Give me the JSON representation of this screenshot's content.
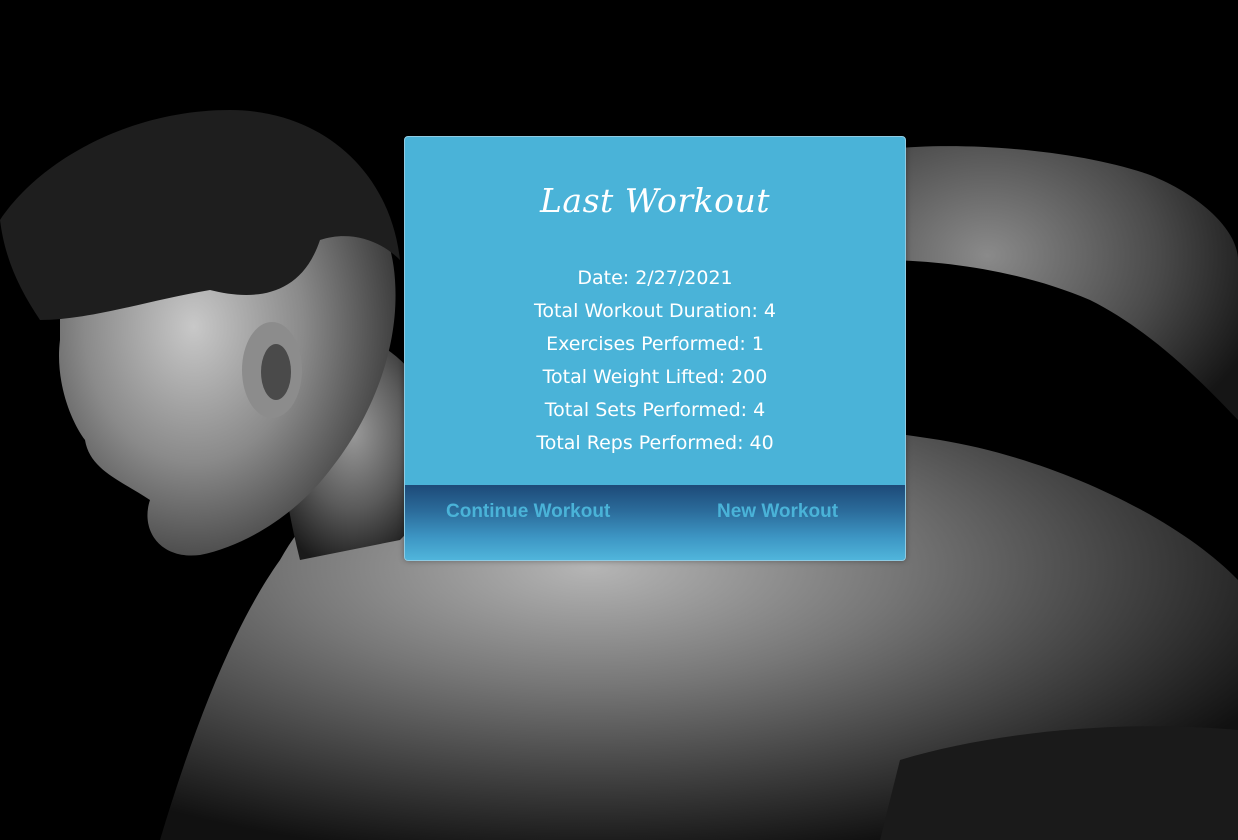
{
  "card": {
    "title": "Last Workout",
    "stats": [
      {
        "label": "Date:",
        "value": "2/27/2021"
      },
      {
        "label": "Total Workout Duration:",
        "value": "4"
      },
      {
        "label": "Exercises Performed:",
        "value": "1"
      },
      {
        "label": "Total Weight Lifted:",
        "value": "200"
      },
      {
        "label": "Total Sets Performed:",
        "value": "4"
      },
      {
        "label": "Total Reps Performed:",
        "value": "40"
      }
    ],
    "actions": {
      "continue_label": "Continue Workout",
      "new_label": "New Workout"
    }
  },
  "background": {
    "image": "athlete-photo"
  },
  "colors": {
    "card_bg": "#4ab3d8",
    "footer_top": "#1d4a78",
    "footer_bottom": "#50b5db",
    "button_text": "#4ab3d8",
    "text": "#ffffff"
  }
}
